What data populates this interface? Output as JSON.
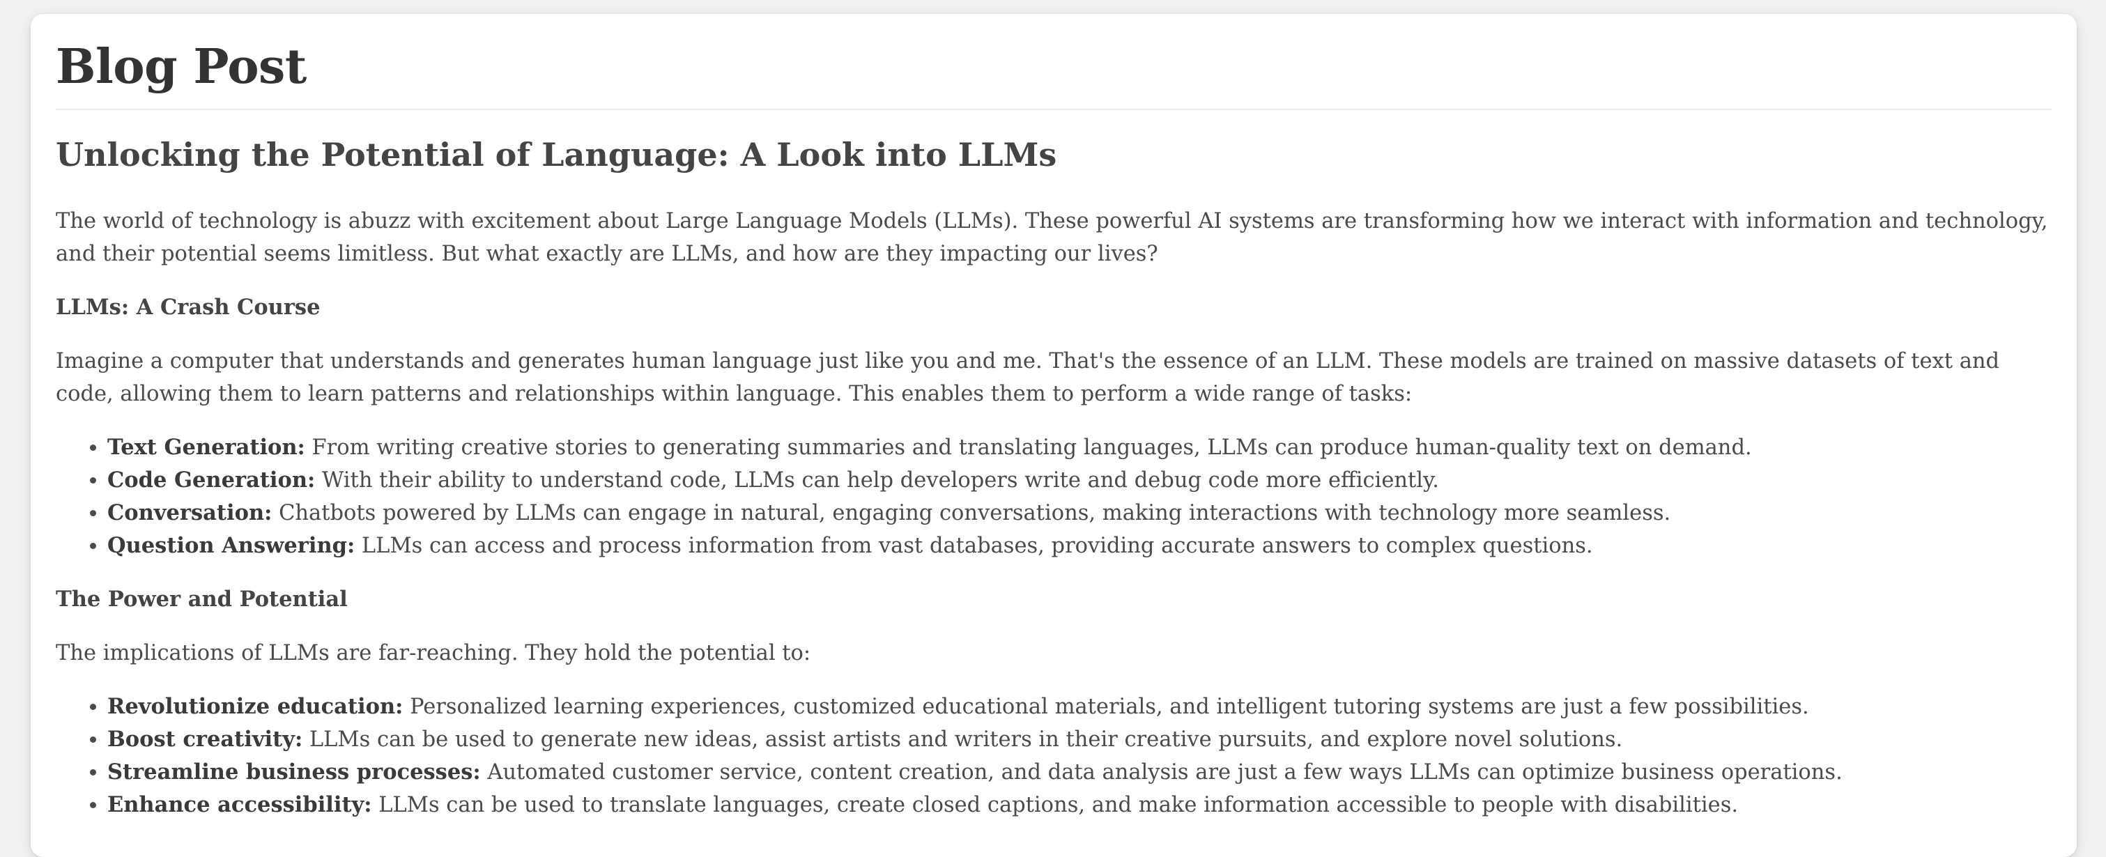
{
  "page": {
    "title": "Blog Post"
  },
  "post": {
    "title": "Unlocking the Potential of Language: A Look into LLMs",
    "intro": "The world of technology is abuzz with excitement about Large Language Models (LLMs). These powerful AI systems are transforming how we interact with information and technology, and their potential seems limitless. But what exactly are LLMs, and how are they impacting our lives?",
    "section1": {
      "heading": "LLMs: A Crash Course",
      "paragraph": "Imagine a computer that understands and generates human language just like you and me. That's the essence of an LLM. These models are trained on massive datasets of text and code, allowing them to learn patterns and relationships within language. This enables them to perform a wide range of tasks:",
      "items": [
        {
          "term": "Text Generation:",
          "text": " From writing creative stories to generating summaries and translating languages, LLMs can produce human-quality text on demand."
        },
        {
          "term": "Code Generation:",
          "text": " With their ability to understand code, LLMs can help developers write and debug code more efficiently."
        },
        {
          "term": "Conversation:",
          "text": " Chatbots powered by LLMs can engage in natural, engaging conversations, making interactions with technology more seamless."
        },
        {
          "term": "Question Answering:",
          "text": " LLMs can access and process information from vast databases, providing accurate answers to complex questions."
        }
      ]
    },
    "section2": {
      "heading": "The Power and Potential",
      "paragraph": "The implications of LLMs are far-reaching. They hold the potential to:",
      "items": [
        {
          "term": "Revolutionize education:",
          "text": " Personalized learning experiences, customized educational materials, and intelligent tutoring systems are just a few possibilities."
        },
        {
          "term": "Boost creativity:",
          "text": " LLMs can be used to generate new ideas, assist artists and writers in their creative pursuits, and explore novel solutions."
        },
        {
          "term": "Streamline business processes:",
          "text": " Automated customer service, content creation, and data analysis are just a few ways LLMs can optimize business operations."
        },
        {
          "term": "Enhance accessibility:",
          "text": " LLMs can be used to translate languages, create closed captions, and make information accessible to people with disabilities."
        }
      ]
    }
  }
}
